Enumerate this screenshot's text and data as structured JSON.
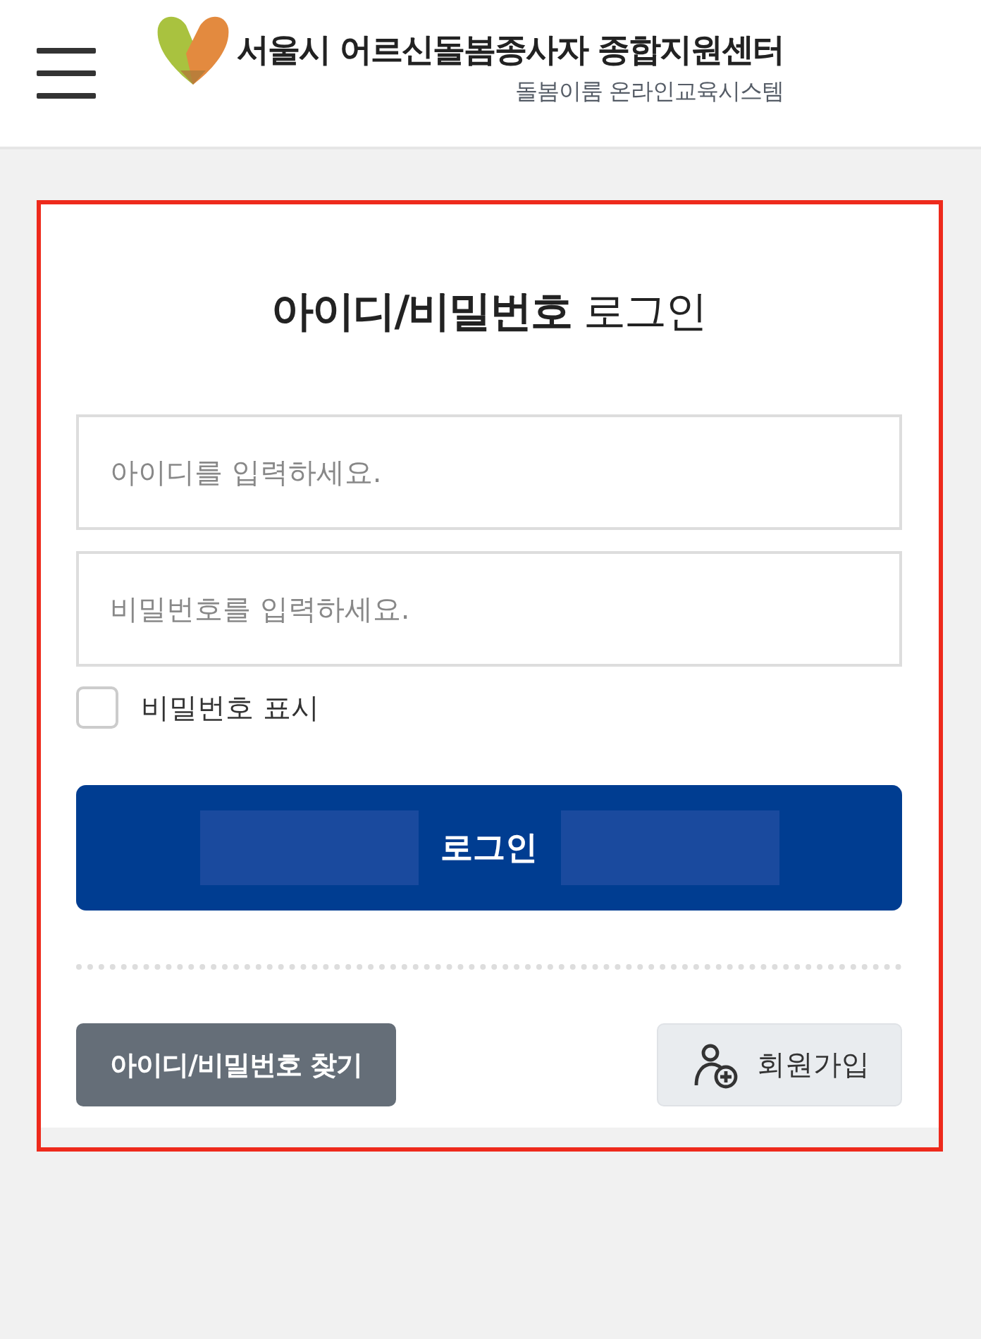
{
  "header": {
    "title": "서울시 어르신돌봄종사자 종합지원센터",
    "subtitle": "돌봄이룸 온라인교육시스템"
  },
  "login": {
    "title": "**아이디/비밀번호** 로그인",
    "fields": [
      {
        "placeholder": "아이디를 입력하세요."
      },
      {
        "placeholder": "비밀번호를 입력하세요."
      }
    ],
    "show_password": {
      "label": "비밀번호 표시",
      "checked": false
    },
    "submit": "로그인",
    "find_button": "아이디/비밀번호 찾기",
    "signup_button": "회원가입"
  }
}
